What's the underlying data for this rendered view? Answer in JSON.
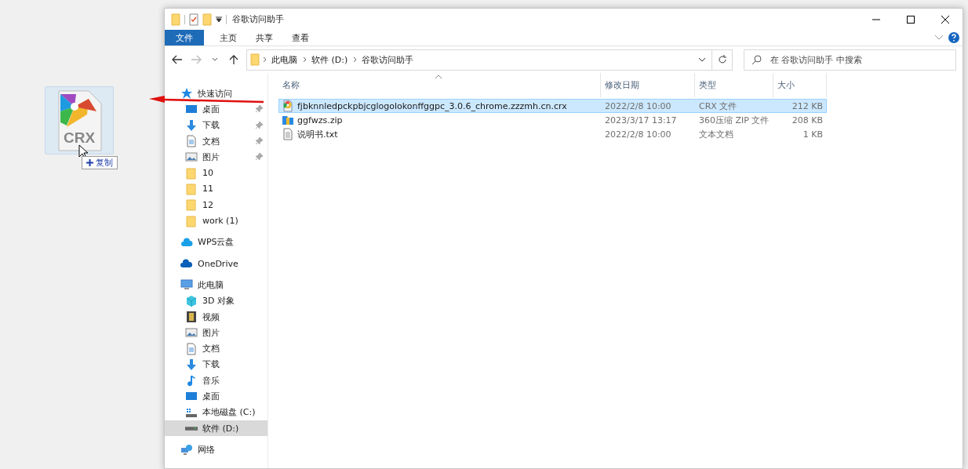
{
  "drag": {
    "label": "CRX",
    "tooltip": "复制"
  },
  "window": {
    "title": "谷歌访问助手"
  },
  "ribbon_tabs": [
    {
      "label": "文件",
      "selected": true
    },
    {
      "label": "主页",
      "selected": false
    },
    {
      "label": "共享",
      "selected": false
    },
    {
      "label": "查看",
      "selected": false
    }
  ],
  "address": {
    "path": [
      "此电脑",
      "软件 (D:)",
      "谷歌访问助手"
    ]
  },
  "search": {
    "placeholder": "在 谷歌访问助手 中搜索"
  },
  "sidebar": [
    {
      "label": "快速访问",
      "kind": "star",
      "selected": false,
      "children": [
        {
          "label": "桌面",
          "kind": "desktop",
          "pinned": true,
          "selected": false
        },
        {
          "label": "下载",
          "kind": "download",
          "pinned": true,
          "selected": false
        },
        {
          "label": "文档",
          "kind": "document",
          "pinned": true,
          "selected": false
        },
        {
          "label": "图片",
          "kind": "image",
          "pinned": true,
          "selected": false
        },
        {
          "label": "10",
          "kind": "folder",
          "pinned": false,
          "selected": false
        },
        {
          "label": "11",
          "kind": "folder",
          "pinned": false,
          "selected": false
        },
        {
          "label": "12",
          "kind": "folder",
          "pinned": false,
          "selected": false
        },
        {
          "label": "work (1)",
          "kind": "folder",
          "pinned": false,
          "selected": false
        }
      ]
    },
    {
      "label": "WPS云盘",
      "kind": "cloud",
      "selected": false
    },
    {
      "label": "OneDrive",
      "kind": "onedrive",
      "selected": false
    },
    {
      "label": "此电脑",
      "kind": "pc",
      "selected": false,
      "children": [
        {
          "label": "3D 对象",
          "kind": "cube",
          "pinned": false,
          "selected": false
        },
        {
          "label": "视频",
          "kind": "video",
          "pinned": false,
          "selected": false
        },
        {
          "label": "图片",
          "kind": "image",
          "pinned": false,
          "selected": false
        },
        {
          "label": "文档",
          "kind": "document",
          "pinned": false,
          "selected": false
        },
        {
          "label": "下载",
          "kind": "download",
          "pinned": false,
          "selected": false
        },
        {
          "label": "音乐",
          "kind": "music",
          "pinned": false,
          "selected": false
        },
        {
          "label": "桌面",
          "kind": "desktop",
          "pinned": false,
          "selected": false
        },
        {
          "label": "本地磁盘 (C:)",
          "kind": "windrive",
          "pinned": false,
          "selected": false
        },
        {
          "label": "软件 (D:)",
          "kind": "drive",
          "pinned": false,
          "selected": true
        }
      ]
    },
    {
      "label": "网络",
      "kind": "network",
      "selected": false
    }
  ],
  "table": {
    "columns": [
      "名称",
      "修改日期",
      "类型",
      "大小"
    ],
    "rows": [
      {
        "kind": "crx",
        "name": "fjbknnledpckpbjcglogolokonffggpc_3.0.6_chrome.zzzmh.cn.crx",
        "date": "2022/2/8 10:00",
        "type": "CRX 文件",
        "size": "212 KB",
        "selected": true
      },
      {
        "kind": "zip",
        "name": "ggfwzs.zip",
        "date": "2023/3/17 13:17",
        "type": "360压缩 ZIP 文件",
        "size": "208 KB",
        "selected": false
      },
      {
        "kind": "txt",
        "name": "说明书.txt",
        "date": "2022/2/8 10:00",
        "type": "文本文档",
        "size": "1 KB",
        "selected": false
      }
    ]
  }
}
